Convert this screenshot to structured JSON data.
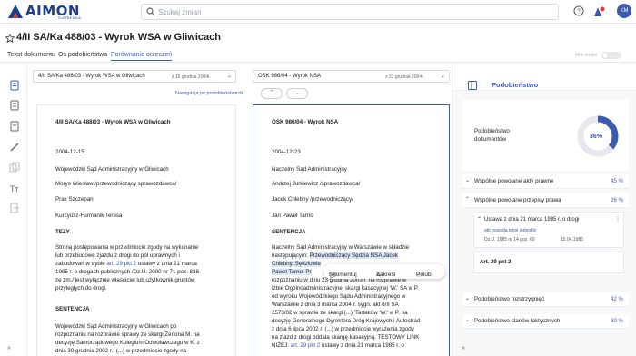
{
  "brand": {
    "name": "AIMON",
    "sub": "CURRENDA"
  },
  "search": {
    "placeholder": "Szukaj zmian"
  },
  "user": {
    "initials": "KM"
  },
  "doc_title": "4/II SA/Ka 488/03 - Wyrok WSA w Gliwicach",
  "tabs": [
    {
      "label": "Tekst dokumentu"
    },
    {
      "label": "Oś podobieństwa"
    },
    {
      "label": "Porównanie orzeczeń"
    }
  ],
  "mini_model": "Mini model",
  "compare": {
    "left": {
      "label": "4/II SA/Ka 488/03 - Wyrok WSA w Gliwicach",
      "date": "z 15 grudnia 2004r."
    },
    "right": {
      "label": "OSK 986/04 - Wyrok NSA",
      "date": "z 23 grudnia 2004r."
    },
    "nav_label": "Nawigacja po podobieństwach"
  },
  "left_doc": {
    "heading": "4/II SA/Ka 488/03 - Wyrok WSA w Gliwicach",
    "date": "2004-12-15",
    "court": "Wojewódzki Sąd Administracyjny w Gliwicach",
    "judge1": "Morys Wiesław /przewodniczący sprawozdawca/",
    "judge2": "Prax Szczepan",
    "judge3": "Kurcyusz-Furmanik Teresa",
    "section1": "TEZY",
    "para1a": "Stroną postępowania w przedmiocie zgody na wykonanie",
    "para1b": "lub przebudowę zjazdu z drogi do pól uprawnych i",
    "para1c_pre": "zabudowań w trybie ",
    "para1c_link": "art. 29 pkt 2",
    "para1c_post": " ustawy z dnia 21 marca",
    "para1d": "1985 r. o drogach publicznych /Dz.U. 2000 nr 71 poz. 838",
    "para1e": "ze zm./ jest wyłącznie właściciel lub użytkownik gruntów",
    "para1f": "przyległych do drogi.",
    "section2": "SENTENCJA",
    "para2a": "Wojewódzki Sąd Administracyjny w Gliwicach po",
    "para2b": "rozpoznaniu na rozprawie sprawy ze skargi Zenona M. na",
    "para2c": "decyzję Samorządowego Kolegium Odwoławczego w K. z",
    "para2d": "dnia 30 grudnia 2002 r., (...) w przedmiocie zgody na"
  },
  "right_doc": {
    "heading": "OSK 986/04 - Wyrok NSA",
    "date": "2004-12-23",
    "court": "Naczelny Sąd Administracyjny",
    "judge1": "Andrzej Jurkiewicz /sprawozdawca/",
    "judge2": "Jacek Chlebny /przewodniczący/",
    "judge3": "Jan Paweł Tarno",
    "section": "SENTENCJA",
    "p1": "Naczelny Sąd Administracyjny w Warszawie w składzie",
    "p2_pre": "następującym: ",
    "p2_hl": "Przewodniczący Sędzia NSA Jacek",
    "p3_hl": "Chlebny, Sędziowie",
    "p4_hl": "Paweł Tarno, Pr",
    "p5": "rozpoznaniu w dniu 23 grudnia 2003 r. na rozprawie w",
    "p6": "Izbie Ogólnoadministracyjnej skargi kasacyjnej 'W.' SA w P.",
    "p7": "od wyroku Wojewódzkiego Sądu Administracyjnego w",
    "p8": "Warszawie z dnia 3 marca 2004 r. sygn. akt 6/II SA",
    "p9": "2573/02 w sprawie ze skargi (...) 'Tartaków 'W.' w P. na",
    "p10": "decyzję Generalnego Dyrektora Dróg Krajowych i Autostrad",
    "p11": "z dnia 6 lipca 2002 r. (...) w przedmiocie wyrażenia zgody",
    "p12": "na zjazd z drogi oddala skargę kasacyjną. TESTOWY LINK",
    "p13_pre": "NIŻEJ: ",
    "p13_link": "art. 29 pkt 2",
    "p13_post": " ustawy z dnia 21 marca 1985 r. o"
  },
  "popup": {
    "comment": "Skomentuj",
    "mark": "Zakreśl",
    "like": "Polub"
  },
  "right_panel": {
    "title": "Podobieństwo",
    "similarity_label_1": "Podobieństwo",
    "similarity_label_2": "dokumentów",
    "similarity_value": "36%",
    "similarity_fraction": 0.36,
    "rows": [
      {
        "label": "Wspólne powołane akty prawne",
        "pct": "45 %"
      },
      {
        "label": "Wspólne powołane przepisy prawa",
        "pct": "26 %"
      }
    ],
    "law": {
      "title": "Ustawa z dnia 21 marca 1985 r. o drogi",
      "tag": "akt posiada tekst jednolity",
      "ref": "Dz.U. 1985 nr 14 poz. 60",
      "date": "15.04.1985",
      "article": "Art. 29 pkt 2"
    },
    "rows2": [
      {
        "label": "Podobieństwo rozstrzygnięć",
        "pct": "42 %"
      },
      {
        "label": "Podobieństwo stanów faktycznych",
        "pct": "30 %"
      }
    ]
  }
}
